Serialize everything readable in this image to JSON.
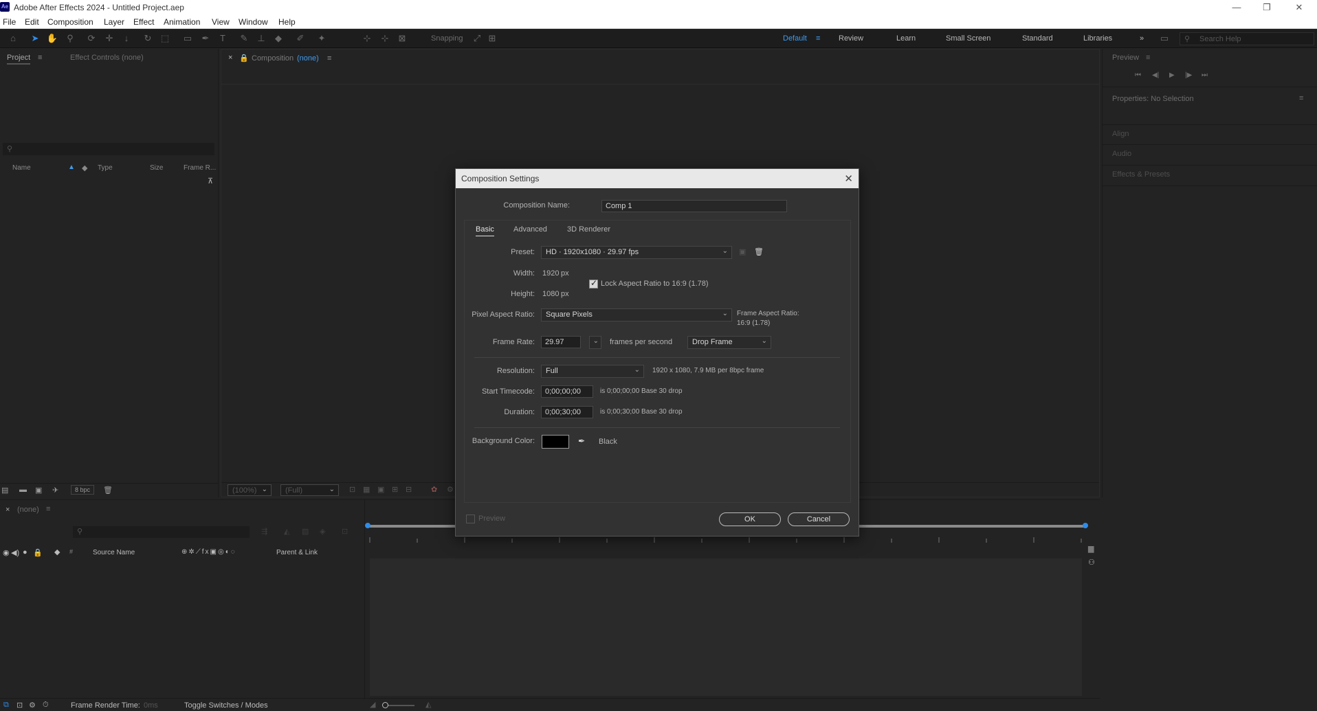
{
  "window": {
    "app_icon": "Ae",
    "title": "Adobe After Effects 2024 - Untitled Project.aep",
    "controls": [
      "—",
      "❐",
      "✕"
    ]
  },
  "menu": [
    "File",
    "Edit",
    "Composition",
    "Layer",
    "Effect",
    "Animation",
    "View",
    "Window",
    "Help"
  ],
  "toolbar": {
    "snapping_label": "Snapping",
    "workspaces": [
      "Default",
      "Review",
      "Learn",
      "Small Screen",
      "Standard",
      "Libraries"
    ],
    "active_workspace": "Default",
    "search_placeholder": "Search Help"
  },
  "project_panel": {
    "tab_project": "Project",
    "tab_effect_controls": "Effect Controls (none)",
    "search_placeholder": "",
    "columns": [
      "Name",
      "Type",
      "Size",
      "Frame R..."
    ],
    "bpc": "8 bpc"
  },
  "comp_panel": {
    "tab_prefix": "Composition",
    "tab_name": "(none)",
    "zoom": "(100%)",
    "quality": "(Full)"
  },
  "right_panels": {
    "preview": "Preview",
    "properties": "Properties: No Selection",
    "align": "Align",
    "audio": "Audio",
    "effects_presets": "Effects & Presets"
  },
  "timeline": {
    "tab_name": "(none)",
    "source_name": "Source Name",
    "parent_link": "Parent & Link",
    "hash": "#",
    "frame_render_label": "Frame Render Time:",
    "frame_render_value": "0ms",
    "toggle_label": "Toggle Switches / Modes"
  },
  "dialog": {
    "title": "Composition Settings",
    "comp_name_label": "Composition Name:",
    "comp_name_value": "Comp 1",
    "tabs": [
      "Basic",
      "Advanced",
      "3D Renderer"
    ],
    "active_tab": "Basic",
    "preset_label": "Preset:",
    "preset_value": "HD  ·  1920x1080  ·  29.97 fps",
    "width_label": "Width:",
    "width_value": "1920",
    "height_label": "Height:",
    "height_value": "1080",
    "px": "px",
    "lock_aspect_label": "Lock Aspect Ratio to 16:9 (1.78)",
    "lock_aspect_checked": true,
    "par_label": "Pixel Aspect Ratio:",
    "par_value": "Square Pixels",
    "frame_aspect_label": "Frame Aspect Ratio:",
    "frame_aspect_value": "16:9 (1.78)",
    "frame_rate_label": "Frame Rate:",
    "frame_rate_value": "29.97",
    "fps_label": "frames per second",
    "drop_frame_value": "Drop Frame",
    "resolution_label": "Resolution:",
    "resolution_value": "Full",
    "resolution_info": "1920 x 1080, 7.9 MB per 8bpc frame",
    "start_tc_label": "Start Timecode:",
    "start_tc_value": "0;00;00;00",
    "start_tc_info": "is 0;00;00;00  Base 30   drop",
    "duration_label": "Duration:",
    "duration_value": "0;00;30;00",
    "duration_info": "is 0;00;30;00  Base 30   drop",
    "bg_color_label": "Background Color:",
    "bg_color_name": "Black",
    "bg_color_hex": "#000000",
    "preview_label": "Preview",
    "ok_label": "OK",
    "cancel_label": "Cancel"
  },
  "colors": {
    "accent": "#3d9cf0",
    "panel_bg": "#232323",
    "dialog_bg": "#323232"
  }
}
